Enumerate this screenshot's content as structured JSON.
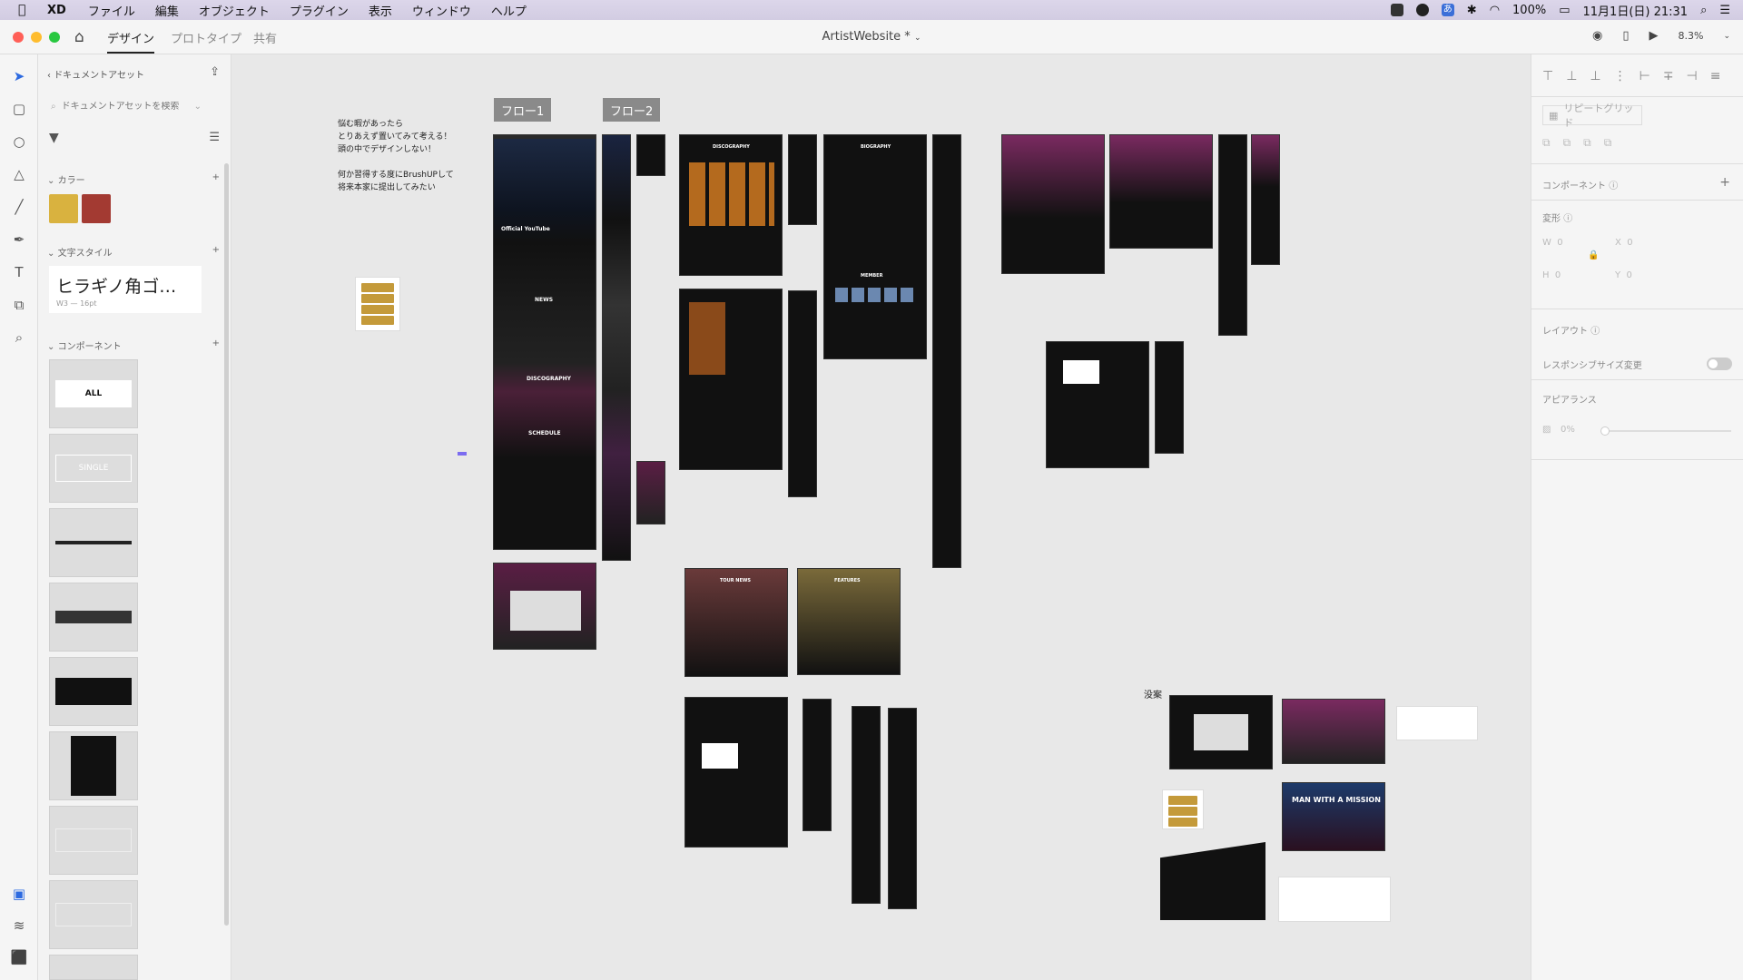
{
  "menubar": {
    "app": "XD",
    "items": [
      "ファイル",
      "編集",
      "オブジェクト",
      "プラグイン",
      "表示",
      "ウィンドウ",
      "ヘルプ"
    ],
    "battery": "100%",
    "datetime": "11月1日(日) 21:31"
  },
  "titlebar": {
    "tabs": [
      "デザイン",
      "プロトタイプ",
      "共有"
    ],
    "doc_title": "ArtistWebsite *",
    "zoom": "8.3%"
  },
  "assets": {
    "back_label": "ドキュメントアセット",
    "search_placeholder": "ドキュメントアセットを検索",
    "colors_label": "カラー",
    "colors": [
      "#d9b23f",
      "#a33a32"
    ],
    "text_styles_label": "文字スタイル",
    "text_style_name": "ヒラギノ角ゴ…",
    "text_style_meta": "W3 — 16pt",
    "components_label": "コンポーネント",
    "components": [
      "ALL",
      "SINGLE"
    ]
  },
  "canvas": {
    "flow1": "フロー1",
    "flow2": "フロー2",
    "note_lines": [
      "悩む暇があったら",
      "とりあえず置いてみて考える！",
      "頭の中でデザインしない！",
      "",
      "何か習得する度にBrushUPして",
      "将来本家に提出してみたい"
    ],
    "rejected_label": "没案",
    "board_titles": [
      "Official YouTube",
      "NEWS",
      "DISCOGRAPHY",
      "SCHEDULE",
      "BIOGRAPHY",
      "MEMBER",
      "MAN WITH A MISSION",
      "TOUR NEWS",
      "FEATURES"
    ]
  },
  "rightpanel": {
    "repeat_grid": "リピートグリッド",
    "component_label": "コンポーネント",
    "transform_label": "変形",
    "w": "0",
    "h": "0",
    "x": "0",
    "y": "0",
    "layout_label": "レイアウト",
    "responsive_label": "レスポンシブサイズ変更",
    "appearance_label": "アピアランス",
    "opacity": "0%"
  }
}
